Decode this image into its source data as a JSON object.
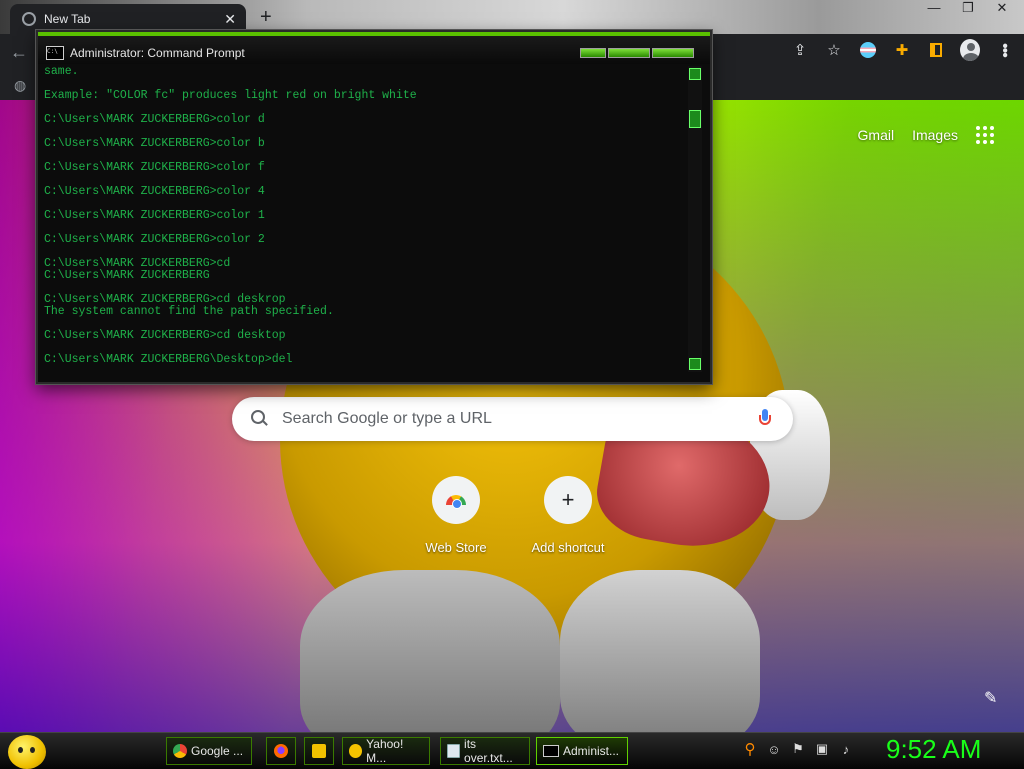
{
  "browser": {
    "tab_title": "New Tab",
    "new_tab": "+",
    "close": "✕",
    "window_controls": {
      "minimize": "—",
      "restore": "❐",
      "close": "✕"
    }
  },
  "toolbar": {
    "back": "←",
    "share": "⇪",
    "star": "☆",
    "puzzle": "✚"
  },
  "bookmarks": {
    "globe": "◍"
  },
  "page": {
    "links": {
      "gmail": "Gmail",
      "images": "Images"
    },
    "search_placeholder": "Search Google or type a URL",
    "shortcuts": [
      {
        "label": "Web Store"
      },
      {
        "label": "Add shortcut",
        "icon_text": "+"
      }
    ],
    "pencil": "✎"
  },
  "cmd": {
    "title": "Administrator: Command Prompt",
    "icon_text": "C:\\",
    "lines": [
      "same.",
      "",
      "Example: \"COLOR fc\" produces light red on bright white",
      "",
      "C:\\Users\\MARK ZUCKERBERG>color d",
      "",
      "C:\\Users\\MARK ZUCKERBERG>color b",
      "",
      "C:\\Users\\MARK ZUCKERBERG>color f",
      "",
      "C:\\Users\\MARK ZUCKERBERG>color 4",
      "",
      "C:\\Users\\MARK ZUCKERBERG>color 1",
      "",
      "C:\\Users\\MARK ZUCKERBERG>color 2",
      "",
      "C:\\Users\\MARK ZUCKERBERG>cd",
      "C:\\Users\\MARK ZUCKERBERG",
      "",
      "C:\\Users\\MARK ZUCKERBERG>cd deskrop",
      "The system cannot find the path specified.",
      "",
      "C:\\Users\\MARK ZUCKERBERG>cd desktop",
      "",
      "C:\\Users\\MARK ZUCKERBERG\\Desktop>del"
    ]
  },
  "taskbar": {
    "tasks": [
      {
        "label": "Google ..."
      },
      {
        "label": "Yahoo! M..."
      },
      {
        "label": "its over.txt..."
      },
      {
        "label": "Administ..."
      }
    ],
    "clock": "9:52 AM"
  },
  "colors": {
    "cmd_text": "#1fb14a",
    "clock": "#19ff19",
    "accent_green": "#5ac000",
    "chrome_bg": "#202124"
  }
}
